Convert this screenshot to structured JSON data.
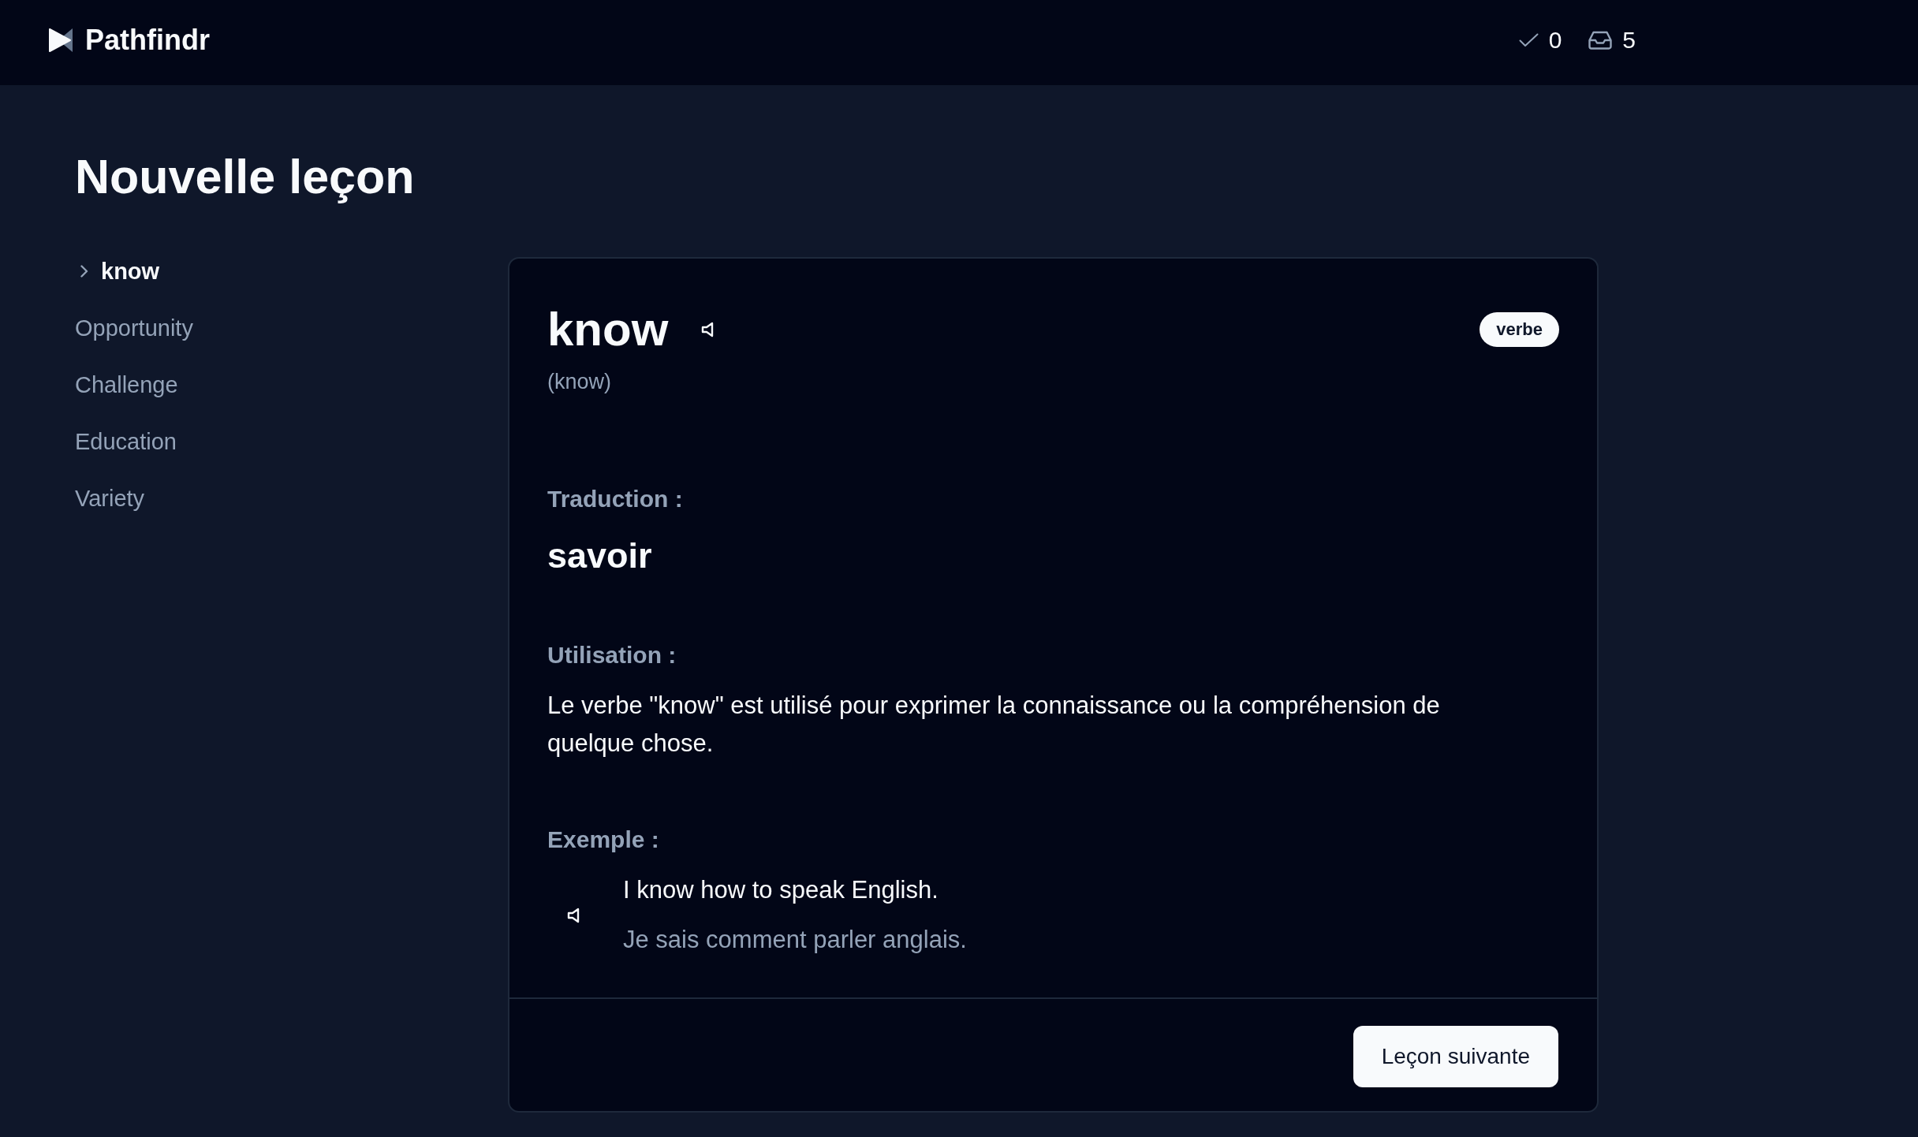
{
  "header": {
    "logo_text": "Pathfindr",
    "stats": [
      {
        "kind": "done",
        "value": "0"
      },
      {
        "kind": "inbox",
        "value": "5"
      }
    ]
  },
  "page": {
    "title": "Nouvelle leçon"
  },
  "sidebar": {
    "items": [
      {
        "label": "know",
        "selected": true
      },
      {
        "label": "Opportunity",
        "selected": false
      },
      {
        "label": "Challenge",
        "selected": false
      },
      {
        "label": "Education",
        "selected": false
      },
      {
        "label": "Variety",
        "selected": false
      }
    ]
  },
  "card": {
    "word": "know",
    "pronunciation": "(know)",
    "badge": "verbe",
    "sections": [
      {
        "kind": "translation",
        "heading": "Traduction :",
        "text": "savoir"
      },
      {
        "kind": "usage",
        "heading": "Utilisation :",
        "text": "Le verbe \"know\" est utilisé pour exprimer la connaissance ou la compréhension de quelque chose."
      },
      {
        "kind": "example",
        "heading": "Exemple :",
        "sentence": "I know how to speak English.",
        "translation": "Je sais comment parler anglais."
      }
    ],
    "next_button": "Leçon suivante"
  }
}
